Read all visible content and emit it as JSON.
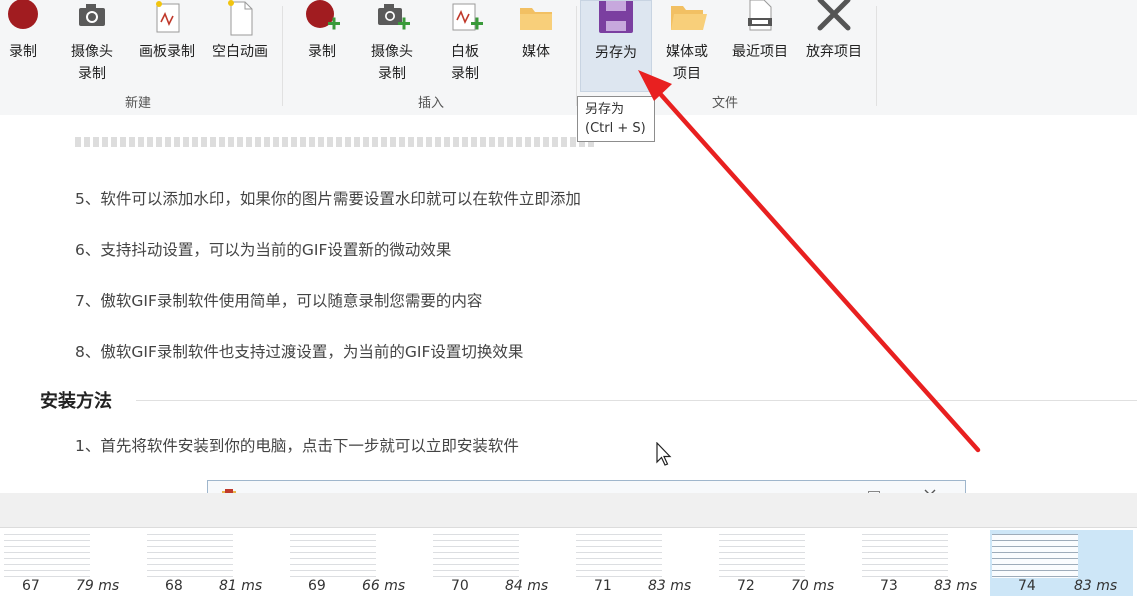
{
  "ribbon": {
    "groups": {
      "new": "新建",
      "insert": "插入",
      "file": "文件"
    },
    "new_buttons": [
      {
        "label": "录制",
        "icon": "record-icon"
      },
      {
        "label": "摄像头\n录制",
        "icon": "camera-icon"
      },
      {
        "label": "画板录制",
        "icon": "board-icon"
      },
      {
        "label": "空白动画",
        "icon": "blank-doc-icon"
      }
    ],
    "insert_buttons": [
      {
        "label": "录制",
        "icon": "record-add-icon"
      },
      {
        "label": "摄像头\n录制",
        "icon": "camera-add-icon"
      },
      {
        "label": "白板\n录制",
        "icon": "board-add-icon"
      },
      {
        "label": "媒体",
        "icon": "folder-icon"
      }
    ],
    "file_buttons": [
      {
        "label": "另存为",
        "icon": "save-icon"
      },
      {
        "label": "媒体或\n项目",
        "icon": "folder-open-icon"
      },
      {
        "label": "最近项目",
        "icon": "recent-icon"
      },
      {
        "label": "放弃项目",
        "icon": "discard-icon"
      }
    ]
  },
  "tooltip": {
    "line1": "另存为",
    "line2": "(Ctrl + S)"
  },
  "document": {
    "paragraphs": [
      "5、软件可以添加水印，如果你的图片需要设置水印就可以在软件立即添加",
      "6、支持抖动设置，可以为当前的GIF设置新的微动效果",
      "7、傲软GIF录制软件使用简单，可以随意录制您需要的内容",
      "8、傲软GIF录制软件也支持过渡设置，为当前的GIF设置切换效果"
    ],
    "heading": "安装方法",
    "install_step": "1、首先将软件安装到你的电脑，点击下一步就可以立即安装软件"
  },
  "filmstrip": {
    "frames": [
      {
        "number": "67",
        "duration": "79 ms"
      },
      {
        "number": "68",
        "duration": "81 ms"
      },
      {
        "number": "69",
        "duration": "66 ms"
      },
      {
        "number": "70",
        "duration": "84 ms"
      },
      {
        "number": "71",
        "duration": "83 ms"
      },
      {
        "number": "72",
        "duration": "70 ms"
      },
      {
        "number": "73",
        "duration": "83 ms"
      },
      {
        "number": "74",
        "duration": "83 ms"
      }
    ],
    "selected_frame": "74"
  },
  "colors": {
    "accent_arrow": "#e82020",
    "save_icon": "#7b3fa0",
    "record_icon": "#a11c20",
    "selected_frame": "#cde6f7"
  }
}
